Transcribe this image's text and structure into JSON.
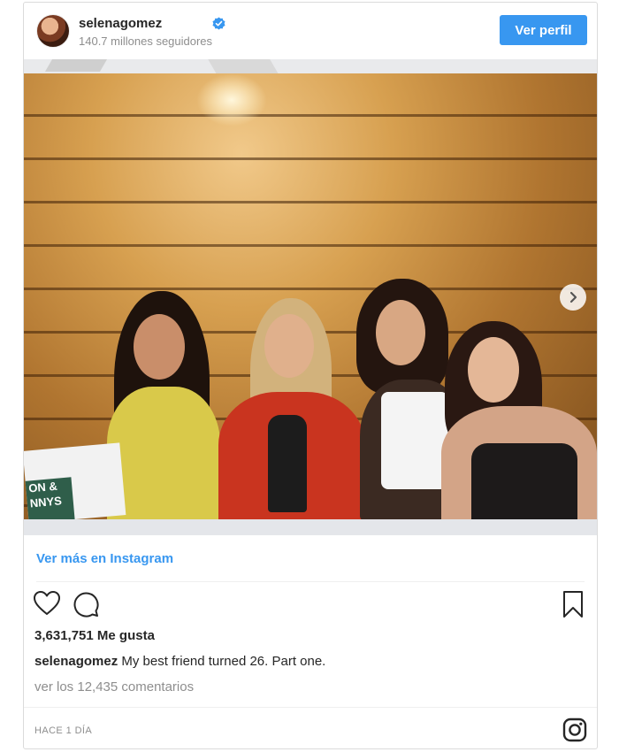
{
  "header": {
    "username": "selenagomez",
    "followers": "140.7 millones seguidores",
    "view_profile_label": "Ver perfil"
  },
  "post": {
    "more_link": "Ver más en Instagram",
    "likes": "3,631,751 Me gusta",
    "caption_user": "selenagomez",
    "caption_text": "My best friend turned 26. Part one.",
    "comments_link": "ver los 12,435 comentarios",
    "timestamp": "HACE 1 DÍA",
    "bag_text": "ON &\nNNYS"
  },
  "colors": {
    "accent": "#3897f0",
    "text": "#262626",
    "muted": "#8e8e8e"
  },
  "icons": [
    "verified-badge-icon",
    "heart-icon",
    "comment-icon",
    "bookmark-icon",
    "next-arrow-icon",
    "instagram-logo-icon"
  ]
}
